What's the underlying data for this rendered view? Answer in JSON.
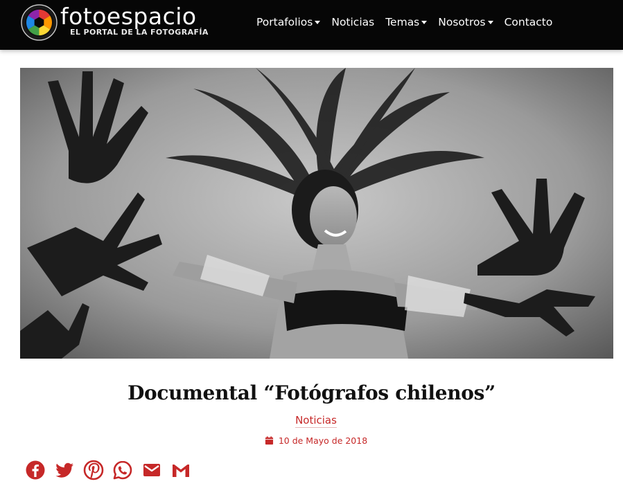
{
  "header": {
    "brand_name": "fotoespacio",
    "brand_tagline": "EL PORTAL DE LA FOTOGRAFÍA",
    "logo_icon": "aperture-rainbow-icon",
    "nav": [
      {
        "label": "Portafolios",
        "has_dropdown": true
      },
      {
        "label": "Noticias",
        "has_dropdown": false
      },
      {
        "label": "Temas",
        "has_dropdown": true
      },
      {
        "label": "Nosotros",
        "has_dropdown": true
      },
      {
        "label": "Contacto",
        "has_dropdown": false
      }
    ]
  },
  "hero": {
    "image": "black-and-white photo of a smiling showgirl with a feathered headdress surrounded by shadows of hands"
  },
  "post": {
    "title": "Documental “Fotógrafos chilenos”",
    "category": "Noticias",
    "date": "10 de Mayo de 2018",
    "date_icon": "calendar-icon"
  },
  "share": [
    {
      "network": "Facebook",
      "icon": "facebook-icon"
    },
    {
      "network": "Twitter",
      "icon": "twitter-icon"
    },
    {
      "network": "Pinterest",
      "icon": "pinterest-icon"
    },
    {
      "network": "WhatsApp",
      "icon": "whatsapp-icon"
    },
    {
      "network": "Email",
      "icon": "email-icon"
    },
    {
      "network": "Gmail",
      "icon": "gmail-icon"
    }
  ],
  "colors": {
    "navbar_bg": "#060606",
    "accent_red": "#c62828",
    "share_icon": "#c62828"
  }
}
